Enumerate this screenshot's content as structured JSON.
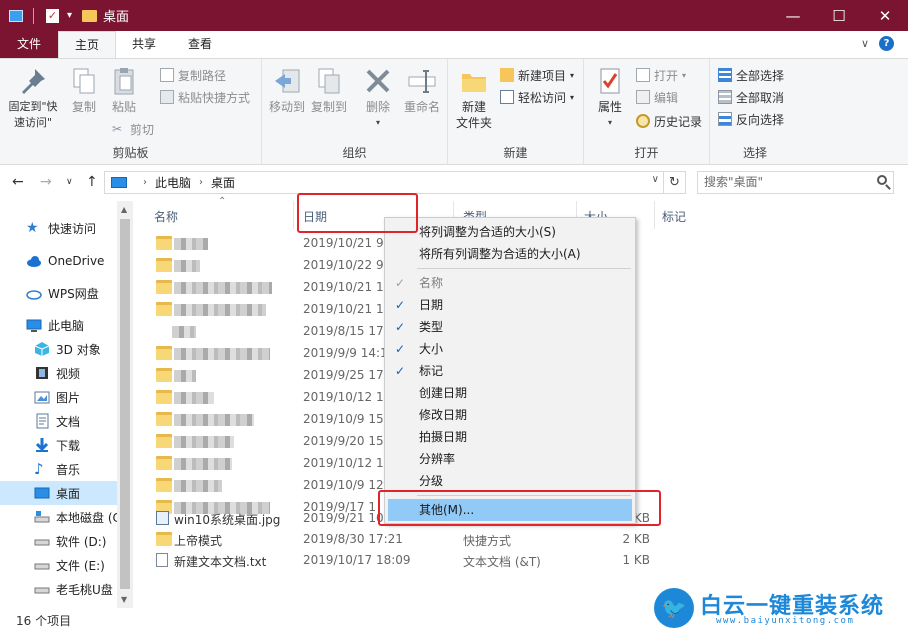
{
  "window": {
    "title": "桌面",
    "minimize": "—",
    "maximize": "☐",
    "close": "✕"
  },
  "ribbon_tabs": [
    {
      "label": "文件"
    },
    {
      "label": "主页"
    },
    {
      "label": "共享"
    },
    {
      "label": "查看"
    }
  ],
  "ribbon_right": {
    "chevron": "∨",
    "help": "?"
  },
  "ribbon": {
    "clipboard": {
      "label": "剪贴板",
      "pin": "固定到\"快速访问\"",
      "copy": "复制",
      "paste": "粘贴",
      "copy_path": "复制路径",
      "paste_shortcut": "粘贴快捷方式",
      "cut": "剪切"
    },
    "organize": {
      "label": "组织",
      "move_to": "移动到",
      "copy_to": "复制到",
      "delete": "删除",
      "rename": "重命名"
    },
    "new": {
      "label": "新建",
      "new_folder": "新建\n文件夹",
      "new_item": "新建项目",
      "easy_access": "轻松访问"
    },
    "open": {
      "label": "打开",
      "properties": "属性",
      "open": "打开",
      "edit": "编辑",
      "history": "历史记录"
    },
    "select": {
      "label": "选择",
      "select_all": "全部选择",
      "select_none": "全部取消",
      "invert": "反向选择"
    }
  },
  "address": {
    "crumbs": [
      "此电脑",
      "桌面"
    ],
    "search_placeholder": "搜索\"桌面\""
  },
  "nav": [
    {
      "label": "快速访问"
    },
    {
      "label": "OneDrive"
    },
    {
      "label": "WPS网盘"
    },
    {
      "label": "此电脑"
    },
    {
      "label": "3D 对象"
    },
    {
      "label": "视频"
    },
    {
      "label": "图片"
    },
    {
      "label": "文档"
    },
    {
      "label": "下载"
    },
    {
      "label": "音乐"
    },
    {
      "label": "桌面"
    },
    {
      "label": "本地磁盘 (C"
    },
    {
      "label": "软件 (D:)"
    },
    {
      "label": "文件 (E:)"
    },
    {
      "label": "老毛桃U盘"
    }
  ],
  "columns": {
    "name": "名称",
    "date": "日期",
    "type": "类型",
    "size": "大小",
    "tags": "标记"
  },
  "files": [
    {
      "date": "2019/10/21 9:",
      "type": "",
      "size": ""
    },
    {
      "date": "2019/10/22 9:",
      "type": "",
      "size": ""
    },
    {
      "date": "2019/10/21 12",
      "type": "",
      "size": ""
    },
    {
      "date": "2019/10/21 12",
      "type": "",
      "size": ""
    },
    {
      "date": "2019/8/15 17:",
      "type": "",
      "size": ""
    },
    {
      "date": "2019/9/9 14:1",
      "type": "",
      "size": ""
    },
    {
      "date": "2019/9/25 17:",
      "type": "",
      "size": ""
    },
    {
      "date": "2019/10/12 16",
      "type": "",
      "size": ""
    },
    {
      "date": "2019/10/9 15:",
      "type": "",
      "size": ""
    },
    {
      "date": "2019/9/20 15:",
      "type": "",
      "size": ""
    },
    {
      "date": "2019/10/12 16",
      "type": "",
      "size": ""
    },
    {
      "date": "2019/10/9 12:",
      "type": "",
      "size": ""
    },
    {
      "date": "2019/9/17 1",
      "type": "",
      "size": ""
    },
    {
      "name": "win10系统桌面.jpg",
      "date": "2019/9/21 10",
      "type": "",
      "size": "KB"
    },
    {
      "name": "上帝模式",
      "date": "2019/8/30 17:21",
      "type": "快捷方式",
      "size": "2 KB"
    },
    {
      "name": "新建文本文档.txt",
      "date": "2019/10/17 18:09",
      "type": "文本文档 (&T)",
      "size": "1 KB"
    }
  ],
  "context_menu": {
    "size_column": "将列调整为合适的大小(S)",
    "size_all": "将所有列调整为合适的大小(A)",
    "name": "名称",
    "date": "日期",
    "type": "类型",
    "size": "大小",
    "tags": "标记",
    "created": "创建日期",
    "modified": "修改日期",
    "taken": "拍摄日期",
    "resolution": "分辨率",
    "rating": "分级",
    "more": "其他(M)...",
    "check": "✓"
  },
  "status": {
    "count": "16 个项目"
  },
  "watermark": {
    "text": "白云一键重装系统",
    "url": "www.baiyunxitong.com"
  }
}
